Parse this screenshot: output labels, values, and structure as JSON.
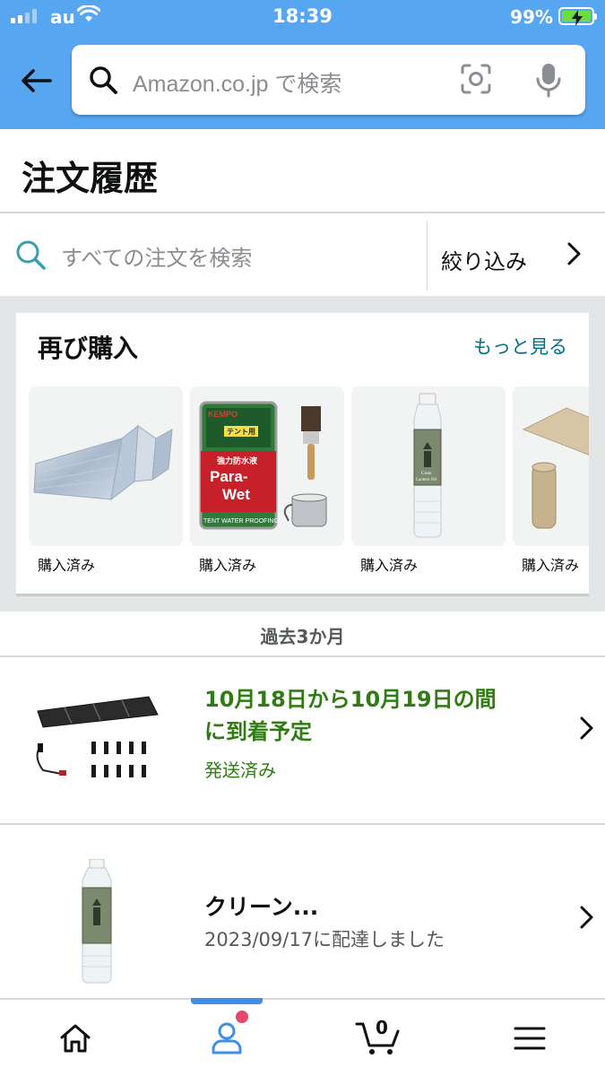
{
  "status_bar": {
    "carrier": "au",
    "time": "18:39",
    "battery_percent": "99%",
    "battery_color": "#6bdd3e"
  },
  "header": {
    "background": "#57a6f1",
    "search_placeholder": "Amazon.co.jp で検索",
    "back_icon": "arrow-left-icon",
    "camera_icon": "camera-scan-icon",
    "mic_icon": "microphone-icon"
  },
  "page": {
    "title": "注文履歴"
  },
  "order_search": {
    "placeholder": "すべての注文を検索",
    "filter_label": "絞り込み"
  },
  "buy_again": {
    "title": "再び購入",
    "see_more": "もっと見る",
    "items": [
      {
        "caption": "購入済み",
        "image": "aluminum-foldable-mat"
      },
      {
        "caption": "購入済み",
        "image": "tent-waterproofing-kit"
      },
      {
        "caption": "購入済み",
        "image": "lantern-oil-bottle"
      },
      {
        "caption": "購入済み",
        "image": "self-inflating-mat"
      }
    ],
    "product_texts": {
      "paint_brand": "KEMPO",
      "paint_tag": "テント用",
      "paint_sub": "強力防水液",
      "paint_name_1": "Para-",
      "paint_name_2": "Wet",
      "paint_bottom": "TENT WATER PROOFING",
      "oil_label_1": "Clean",
      "oil_label_2": "Lantern Oil"
    }
  },
  "orders_section": {
    "header": "過去3か月",
    "orders": [
      {
        "title_line1": "10月18日から10月19日の間",
        "title_line2": "に到着予定",
        "status": "発送済み",
        "image": "solar-panel-kit"
      },
      {
        "title": "クリーン...",
        "status": "2023/09/17に配達しました",
        "image": "lantern-oil-bottle"
      }
    ]
  },
  "tab_bar": {
    "tabs": [
      "home-icon",
      "account-icon",
      "cart-icon",
      "menu-icon"
    ],
    "active": "account-icon",
    "cart_count": "0",
    "accent": "#3f8ee8",
    "notification_color": "#e04a6b"
  }
}
